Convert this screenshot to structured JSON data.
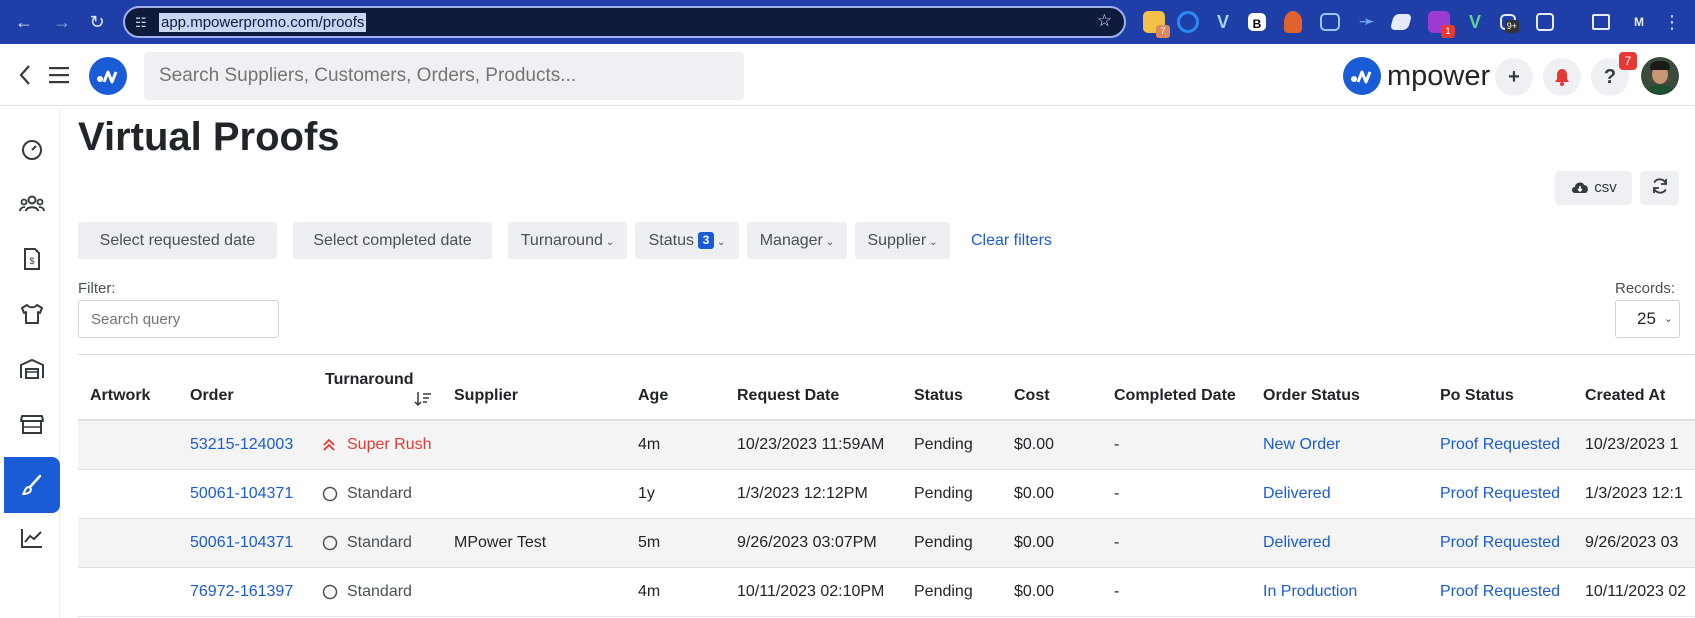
{
  "browser": {
    "url": "app.mpowerpromo.com/proofs",
    "extension_badges": {
      "first": "7",
      "second": "1",
      "third": "9+"
    }
  },
  "header": {
    "search_placeholder": "Search Suppliers, Customers, Orders, Products...",
    "brand_name": "mpower",
    "help_badge": "7"
  },
  "page": {
    "title": "Virtual Proofs",
    "csv_label": "csv"
  },
  "filters": {
    "requested_date": "Select requested date",
    "completed_date": "Select completed date",
    "turnaround": "Turnaround",
    "status": "Status",
    "status_count": "3",
    "manager": "Manager",
    "supplier": "Supplier",
    "clear": "Clear filters"
  },
  "filter_bar": {
    "label": "Filter:",
    "placeholder": "Search query",
    "records_label": "Records:",
    "records_value": "25"
  },
  "table": {
    "columns": {
      "artwork": "Artwork",
      "order": "Order",
      "turnaround": "Turnaround",
      "supplier": "Supplier",
      "age": "Age",
      "request_date": "Request Date",
      "status": "Status",
      "cost": "Cost",
      "completed_date": "Completed Date",
      "order_status": "Order Status",
      "po_status": "Po Status",
      "created_at": "Created At"
    },
    "rows": [
      {
        "order": "53215-124003",
        "turnaround": "Super Rush",
        "supplier": "",
        "age": "4m",
        "request_date": "10/23/2023 11:59AM",
        "status": "Pending",
        "cost": "$0.00",
        "completed_date": "-",
        "order_status": "New Order",
        "po_status": "Proof Requested",
        "created_at": "10/23/2023 1"
      },
      {
        "order": "50061-104371",
        "turnaround": "Standard",
        "supplier": "",
        "age": "1y",
        "request_date": "1/3/2023 12:12PM",
        "status": "Pending",
        "cost": "$0.00",
        "completed_date": "-",
        "order_status": "Delivered",
        "po_status": "Proof Requested",
        "created_at": "1/3/2023 12:1"
      },
      {
        "order": "50061-104371",
        "turnaround": "Standard",
        "supplier": "MPower Test",
        "age": "5m",
        "request_date": "9/26/2023 03:07PM",
        "status": "Pending",
        "cost": "$0.00",
        "completed_date": "-",
        "order_status": "Delivered",
        "po_status": "Proof Requested",
        "created_at": "9/26/2023 03"
      },
      {
        "order": "76972-161397",
        "turnaround": "Standard",
        "supplier": "",
        "age": "4m",
        "request_date": "10/11/2023 02:10PM",
        "status": "Pending",
        "cost": "$0.00",
        "completed_date": "-",
        "order_status": "In Production",
        "po_status": "Proof Requested",
        "created_at": "10/11/2023 02"
      }
    ]
  },
  "colors": {
    "accent": "#1a5bd6",
    "rush": "#e53935",
    "browser_bar": "#1f3ea8"
  }
}
